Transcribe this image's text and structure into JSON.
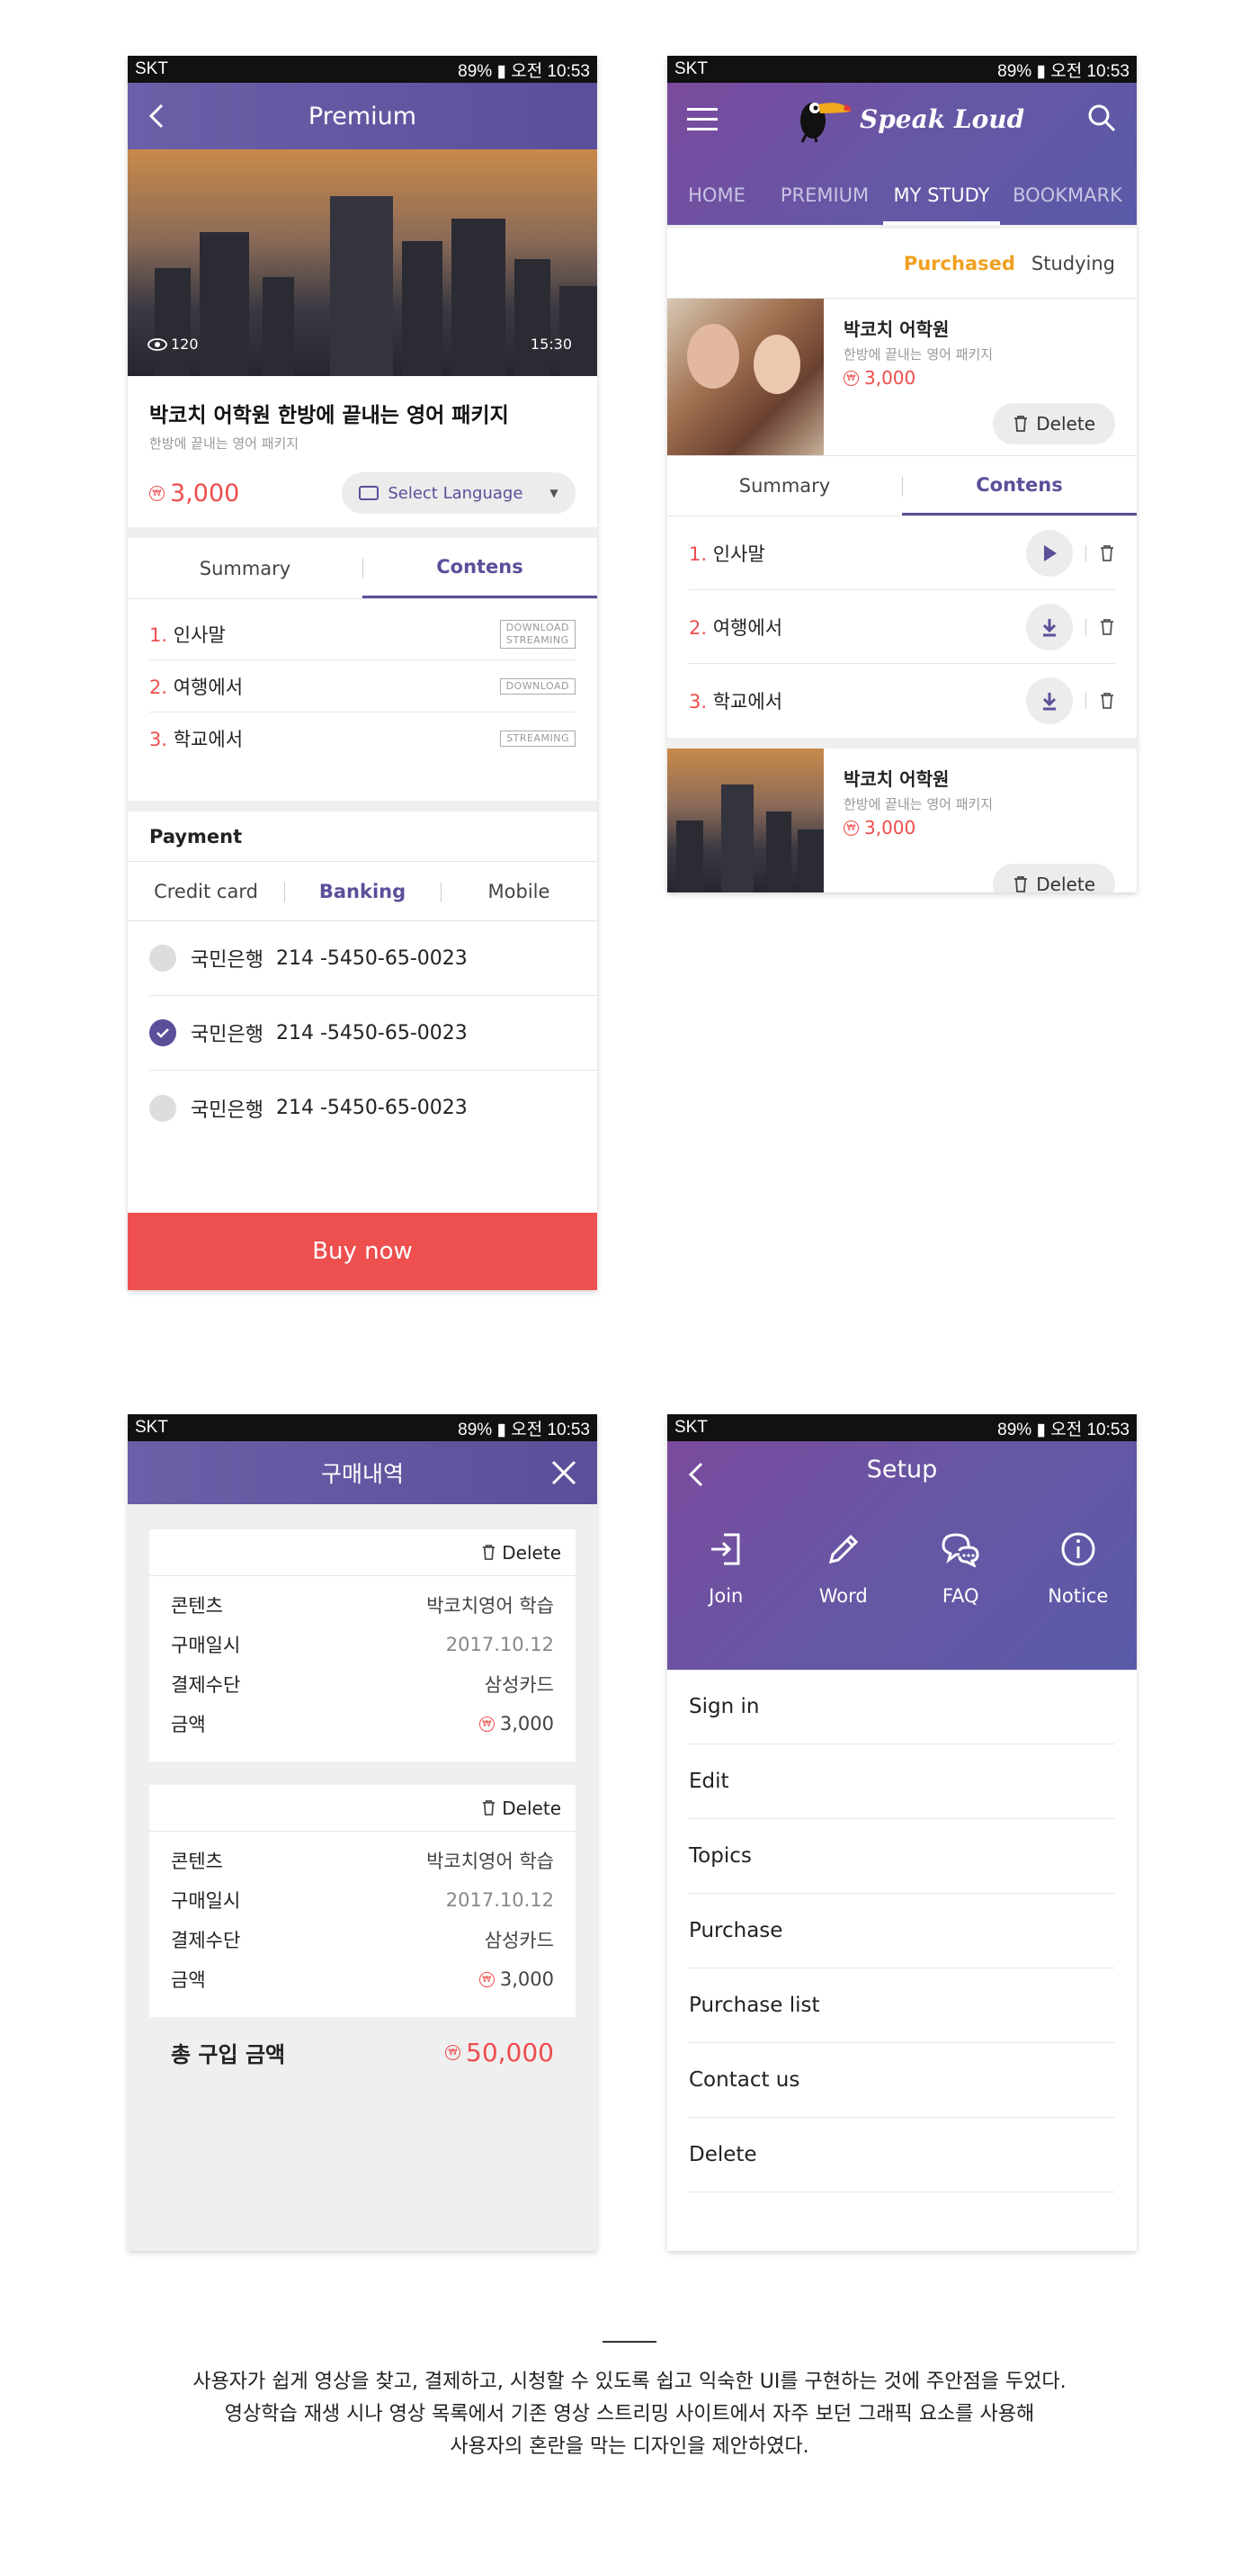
{
  "status": {
    "carrier": "SKT",
    "right": "89% ▮ 오전 10:53"
  },
  "p1": {
    "title": "Premium",
    "views": "120",
    "duration": "15:30",
    "course_title": "박코치 어학원 한방에 끝내는 영어 패키지",
    "course_sub": "한방에 끝내는 영어 패키지",
    "price": "3,000",
    "select_language": "Select Language",
    "tab_summary": "Summary",
    "tab_contents": "Contens",
    "items": [
      {
        "num": "1.",
        "title": "인사말",
        "tags": [
          "DOWNLOAD",
          "STREAMING"
        ]
      },
      {
        "num": "2.",
        "title": "여행에서",
        "tags": [
          "DOWNLOAD"
        ]
      },
      {
        "num": "3.",
        "title": "학교에서",
        "tags": [
          "STREAMING"
        ]
      }
    ],
    "payment_label": "Payment",
    "pay_tabs": [
      "Credit card",
      "Banking",
      "Mobile"
    ],
    "banks": [
      {
        "name": "국민은행",
        "acct": "214 -5450-65-0023",
        "checked": false
      },
      {
        "name": "국민은행",
        "acct": "214 -5450-65-0023",
        "checked": true
      },
      {
        "name": "국민은행",
        "acct": "214 -5450-65-0023",
        "checked": false
      }
    ],
    "buy_now": "Buy now"
  },
  "p2": {
    "logo": "Speak Loud",
    "nav": [
      "HOME",
      "PREMIUM",
      "MY STUDY",
      "BOOKMARK"
    ],
    "filter_purchased": "Purchased",
    "filter_studying": "Studying",
    "cards": [
      {
        "title": "박코치 어학원",
        "sub": "한방에 끝내는 영어 패키지",
        "price": "3,000",
        "delete": "Delete"
      },
      {
        "title": "박코치 어학원",
        "sub": "한방에 끝내는 영어 패키지",
        "price": "3,000",
        "delete": "Delete"
      }
    ],
    "tab_summary": "Summary",
    "tab_contents": "Contens",
    "items": [
      {
        "num": "1.",
        "title": "인사말",
        "action": "play"
      },
      {
        "num": "2.",
        "title": "여행에서",
        "action": "download"
      },
      {
        "num": "3.",
        "title": "학교에서",
        "action": "download"
      }
    ]
  },
  "p3": {
    "title": "구매내역",
    "receipts": [
      {
        "delete": "Delete",
        "rows": [
          {
            "k": "콘텐츠",
            "v": "박코치영어 학습"
          },
          {
            "k": "구매일시",
            "v": "2017.10.12"
          },
          {
            "k": "결제수단",
            "v": "삼성카드"
          },
          {
            "k": "금액",
            "v": "3,000"
          }
        ]
      },
      {
        "delete": "Delete",
        "rows": [
          {
            "k": "콘텐츠",
            "v": "박코치영어 학습"
          },
          {
            "k": "구매일시",
            "v": "2017.10.12"
          },
          {
            "k": "결제수단",
            "v": "삼성카드"
          },
          {
            "k": "금액",
            "v": "3,000"
          }
        ]
      }
    ],
    "total_label": "총 구입 금액",
    "total_value": "50,000"
  },
  "p4": {
    "title": "Setup",
    "quick": [
      {
        "label": "Join",
        "icon": "login-icon"
      },
      {
        "label": "Word",
        "icon": "pencil-icon"
      },
      {
        "label": "FAQ",
        "icon": "chat-bubbles-icon"
      },
      {
        "label": "Notice",
        "icon": "info-icon"
      }
    ],
    "menu": [
      "Sign in",
      "Edit",
      "Topics",
      "Purchase",
      "Purchase list",
      "Contact us",
      "Delete"
    ]
  },
  "caption": {
    "lines": [
      "사용자가 쉽게 영상을 찾고, 결제하고, 시청할 수 있도록 쉽고 익숙한 UI를 구현하는 것에 주안점을 두었다.",
      "영상학습 재생 시나 영상 목록에서 기존 영상 스트리밍 사이트에서 자주 보던 그래픽 요소를 사용해",
      "사용자의 혼란을 막는 디자인을 제안하였다."
    ]
  },
  "colors": {
    "accent": "#5b4f9a",
    "red": "#ee4d4d",
    "orange": "#f0a020"
  }
}
